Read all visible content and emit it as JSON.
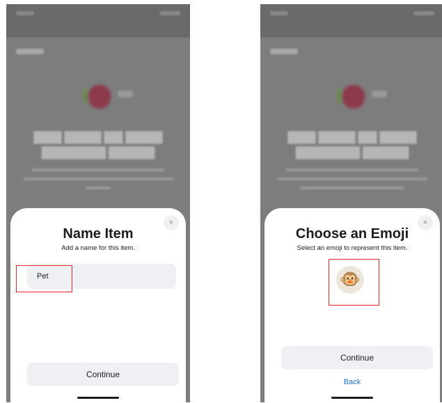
{
  "screens": [
    {
      "sheet": {
        "title": "Name Item",
        "subtitle": "Add a name for this item.",
        "name_value": "Pet",
        "continue_label": "Continue",
        "close_label": "×"
      }
    },
    {
      "sheet": {
        "title": "Choose an Emoji",
        "subtitle": "Select an emoji to represent this item.",
        "emoji": "🐵",
        "continue_label": "Continue",
        "back_label": "Back",
        "close_label": "×"
      }
    }
  ],
  "colors": {
    "highlight": "#e0262b",
    "link": "#1d6fd8",
    "button_fill": "#eef0f4",
    "dim_overlay": "#7d7d7d"
  }
}
